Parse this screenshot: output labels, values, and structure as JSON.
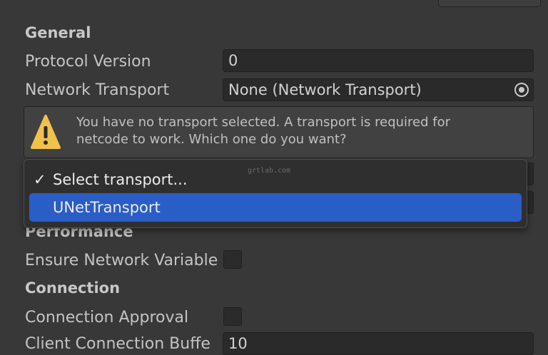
{
  "inspector": {
    "sections": {
      "general": "General",
      "performance": "Performance",
      "connection": "Connection"
    },
    "fields": {
      "protocol_version": {
        "label": "Protocol Version",
        "value": "0"
      },
      "network_transport": {
        "label": "Network Transport",
        "value": "None (Network Transport)",
        "picker_icon": "object-picker-icon"
      },
      "ensure_network_variable": {
        "label": "Ensure Network Variable",
        "checked": false
      },
      "connection_approval": {
        "label": "Connection Approval",
        "checked": false
      },
      "client_connection_buffer": {
        "label": "Client Connection Buffe",
        "value": "10"
      }
    },
    "warning": {
      "icon": "warning-icon",
      "text_line1": "You have no transport selected. A transport is required for",
      "text_line2": "netcode to work. Which one do you want?"
    }
  },
  "dropdown": {
    "items": [
      {
        "check": "✓",
        "label": "Select transport...",
        "selected": false
      },
      {
        "check": "",
        "label": "UNetTransport",
        "selected": true
      }
    ],
    "highlight_color": "#2b5dc6"
  },
  "watermark": "grtlab.com"
}
